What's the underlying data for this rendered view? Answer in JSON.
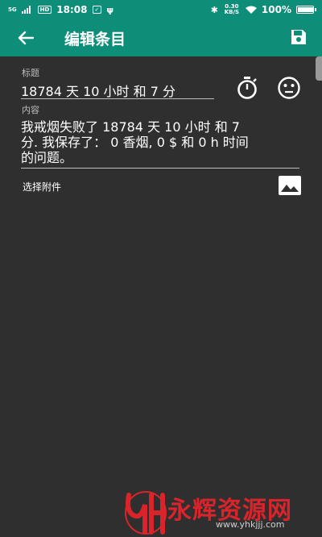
{
  "status_bar": {
    "time": "18:08",
    "signal_label": "5G",
    "hd_label": "HD",
    "speed_label": "0.30 KB/S",
    "battery": "100%",
    "battery_level": 1.0
  },
  "app_bar": {
    "title": "编辑条目",
    "back_icon": "arrow-left-icon",
    "save_icon": "save-icon"
  },
  "form": {
    "title_label": "标题",
    "title_value": "18784 天 10 小时 和 7 分",
    "timer_icon": "stopwatch-icon",
    "mood_icon": "neutral-face-icon",
    "content_label": "内容",
    "content_lines": [
      "我戒烟失败了 18784 天 10 小时 和 7",
      "分. 我保存了：  0 香烟, 0 $ 和 0 h 时间",
      "的问题。"
    ],
    "attach_label": "选择附件",
    "image_icon": "image-icon"
  },
  "watermark": {
    "text": "永辉资源网",
    "url": "www.yhkjjj.com"
  },
  "colors": {
    "accent": "#0e8d79",
    "background": "#2f2f2f",
    "watermark_red": "#d9242b"
  }
}
